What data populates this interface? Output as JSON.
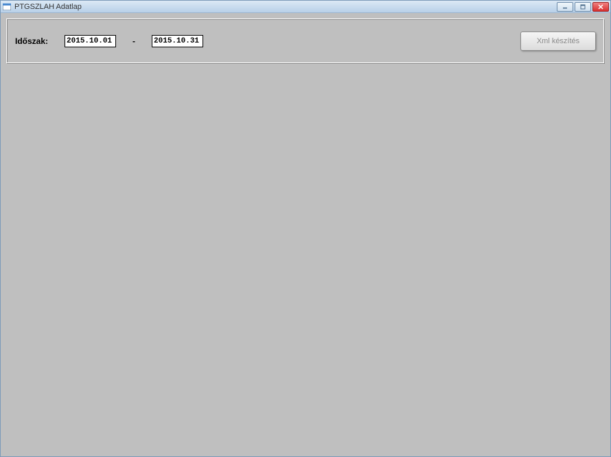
{
  "window": {
    "title": "PTGSZLAH Adatlap"
  },
  "controls": {
    "minimize_tooltip": "Minimize",
    "maximize_tooltip": "Maximize",
    "close_tooltip": "Close"
  },
  "panel": {
    "period_label": "Időszak:",
    "date_from": "2015.10.01",
    "date_separator": "-",
    "date_to": "2015.10.31",
    "xml_button_label": "Xml készítés"
  }
}
